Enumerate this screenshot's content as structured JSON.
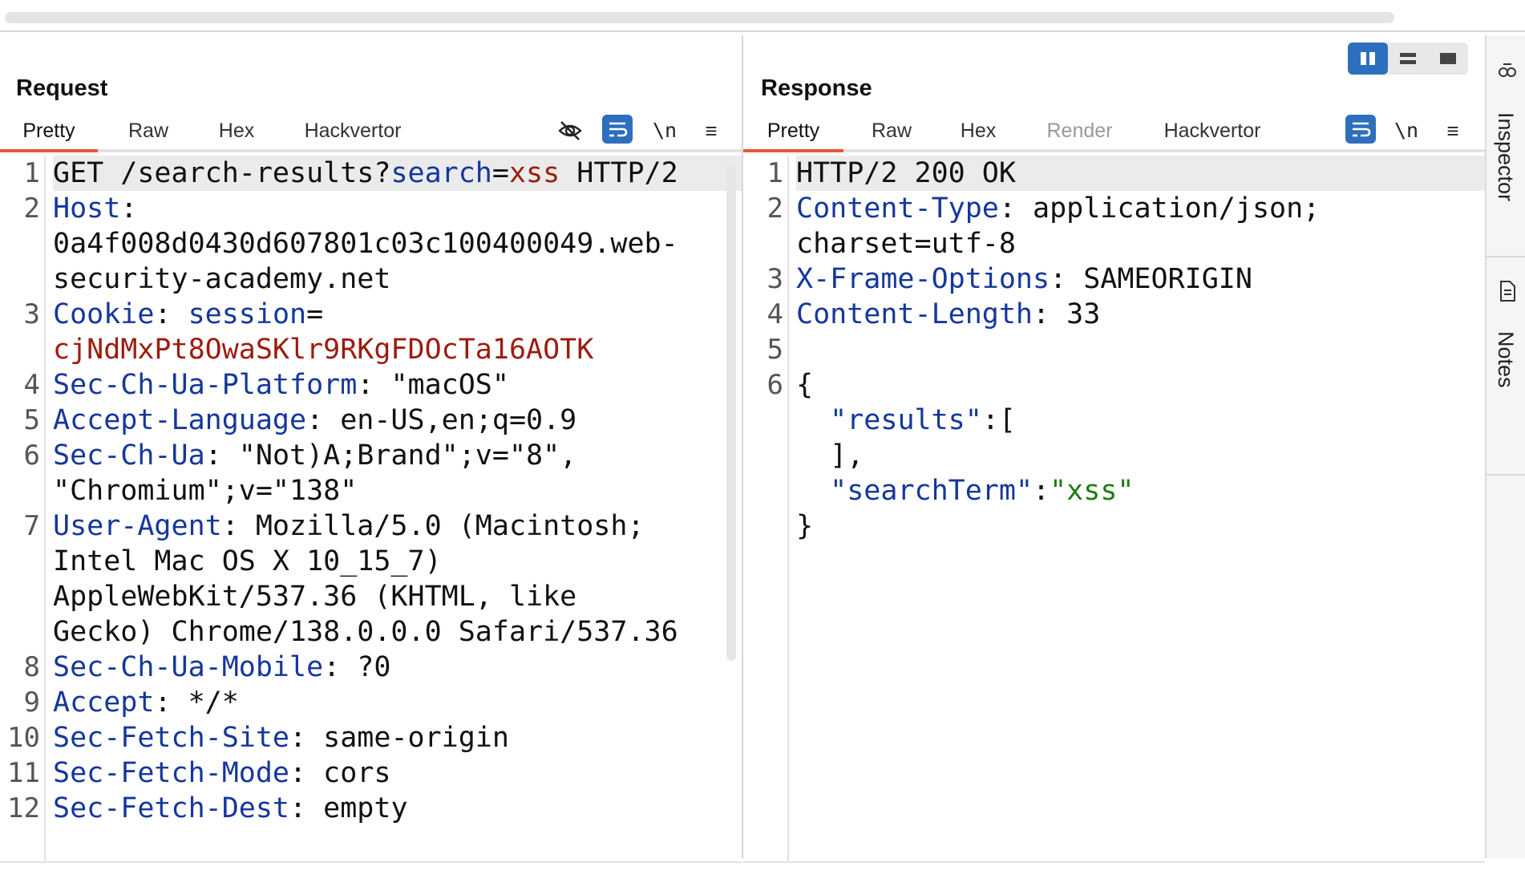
{
  "request": {
    "title": "Request",
    "tabs": [
      "Pretty",
      "Raw",
      "Hex",
      "Hackvertor"
    ],
    "tools": {
      "hide_icon": "eye-slash-icon",
      "wrap_icon": "wrap-icon",
      "newline": "\\n",
      "menu_icon": "menu-icon"
    },
    "lines": [
      {
        "n": "1",
        "parts": [
          {
            "t": "GET /search-results?",
            "c": "v"
          },
          {
            "t": "search",
            "c": "k"
          },
          {
            "t": "=",
            "c": "v"
          },
          {
            "t": "xss",
            "c": "r"
          },
          {
            "t": " HTTP/2",
            "c": "v"
          }
        ]
      },
      {
        "n": "2",
        "parts": [
          {
            "t": "Host",
            "c": "k"
          },
          {
            "t": ":",
            "c": "v"
          }
        ]
      },
      {
        "n": "",
        "parts": [
          {
            "t": "0a4f008d0430d607801c03c100400049.web-",
            "c": "v"
          }
        ]
      },
      {
        "n": "",
        "parts": [
          {
            "t": "security-academy.net",
            "c": "v"
          }
        ]
      },
      {
        "n": "3",
        "parts": [
          {
            "t": "Cookie",
            "c": "k"
          },
          {
            "t": ": ",
            "c": "v"
          },
          {
            "t": "session",
            "c": "k"
          },
          {
            "t": "=",
            "c": "v"
          }
        ]
      },
      {
        "n": "",
        "parts": [
          {
            "t": "cjNdMxPt8OwaSKlr9RKgFDOcTa16AOTK",
            "c": "r"
          }
        ]
      },
      {
        "n": "4",
        "parts": [
          {
            "t": "Sec-Ch-Ua-Platform",
            "c": "k"
          },
          {
            "t": ": \"macOS\"",
            "c": "v"
          }
        ]
      },
      {
        "n": "5",
        "parts": [
          {
            "t": "Accept-Language",
            "c": "k"
          },
          {
            "t": ": en-US,en;q=0.9",
            "c": "v"
          }
        ]
      },
      {
        "n": "6",
        "parts": [
          {
            "t": "Sec-Ch-Ua",
            "c": "k"
          },
          {
            "t": ": \"Not)A;Brand\";v=\"8\",",
            "c": "v"
          }
        ]
      },
      {
        "n": "",
        "parts": [
          {
            "t": "\"Chromium\";v=\"138\"",
            "c": "v"
          }
        ]
      },
      {
        "n": "7",
        "parts": [
          {
            "t": "User-Agent",
            "c": "k"
          },
          {
            "t": ": Mozilla/5.0 (Macintosh;",
            "c": "v"
          }
        ]
      },
      {
        "n": "",
        "parts": [
          {
            "t": "Intel Mac OS X 10_15_7)",
            "c": "v"
          }
        ]
      },
      {
        "n": "",
        "parts": [
          {
            "t": "AppleWebKit/537.36 (KHTML, like",
            "c": "v"
          }
        ]
      },
      {
        "n": "",
        "parts": [
          {
            "t": "Gecko) Chrome/138.0.0.0 Safari/537.36",
            "c": "v"
          }
        ]
      },
      {
        "n": "8",
        "parts": [
          {
            "t": "Sec-Ch-Ua-Mobile",
            "c": "k"
          },
          {
            "t": ": ?0",
            "c": "v"
          }
        ]
      },
      {
        "n": "9",
        "parts": [
          {
            "t": "Accept",
            "c": "k"
          },
          {
            "t": ": */*",
            "c": "v"
          }
        ]
      },
      {
        "n": "10",
        "parts": [
          {
            "t": "Sec-Fetch-Site",
            "c": "k"
          },
          {
            "t": ": same-origin",
            "c": "v"
          }
        ]
      },
      {
        "n": "11",
        "parts": [
          {
            "t": "Sec-Fetch-Mode",
            "c": "k"
          },
          {
            "t": ": cors",
            "c": "v"
          }
        ]
      },
      {
        "n": "12",
        "parts": [
          {
            "t": "Sec-Fetch-Dest",
            "c": "k"
          },
          {
            "t": ": empty",
            "c": "v"
          }
        ]
      }
    ]
  },
  "response": {
    "title": "Response",
    "tabs": [
      "Pretty",
      "Raw",
      "Hex",
      "Render",
      "Hackvertor"
    ],
    "tools": {
      "wrap_icon": "wrap-icon",
      "newline": "\\n",
      "menu_icon": "menu-icon"
    },
    "lines": [
      {
        "n": "1",
        "parts": [
          {
            "t": "HTTP/2 200 OK",
            "c": "v"
          }
        ]
      },
      {
        "n": "2",
        "parts": [
          {
            "t": "Content-Type",
            "c": "k"
          },
          {
            "t": ": application/json;",
            "c": "v"
          }
        ]
      },
      {
        "n": "",
        "parts": [
          {
            "t": "charset=utf-8",
            "c": "v"
          }
        ]
      },
      {
        "n": "3",
        "parts": [
          {
            "t": "X-Frame-Options",
            "c": "k"
          },
          {
            "t": ": SAMEORIGIN",
            "c": "v"
          }
        ]
      },
      {
        "n": "4",
        "parts": [
          {
            "t": "Content-Length",
            "c": "k"
          },
          {
            "t": ": 33",
            "c": "v"
          }
        ]
      },
      {
        "n": "5",
        "parts": [
          {
            "t": "",
            "c": "v"
          }
        ]
      },
      {
        "n": "6",
        "parts": [
          {
            "t": "{",
            "c": "v"
          }
        ]
      },
      {
        "n": "",
        "parts": [
          {
            "t": "  ",
            "c": "v"
          },
          {
            "t": "\"results\"",
            "c": "jk"
          },
          {
            "t": ":[",
            "c": "v"
          }
        ]
      },
      {
        "n": "",
        "parts": [
          {
            "t": "  ],",
            "c": "v"
          }
        ]
      },
      {
        "n": "",
        "parts": [
          {
            "t": "  ",
            "c": "v"
          },
          {
            "t": "\"searchTerm\"",
            "c": "jk"
          },
          {
            "t": ":",
            "c": "v"
          },
          {
            "t": "\"xss\"",
            "c": "js"
          }
        ]
      },
      {
        "n": "",
        "parts": [
          {
            "t": "}",
            "c": "v"
          }
        ]
      }
    ]
  },
  "layout_switch": {
    "icons": [
      "split-columns-icon",
      "split-rows-icon",
      "single-pane-icon"
    ]
  },
  "sidebar": {
    "inspector": "Inspector",
    "notes": "Notes"
  }
}
